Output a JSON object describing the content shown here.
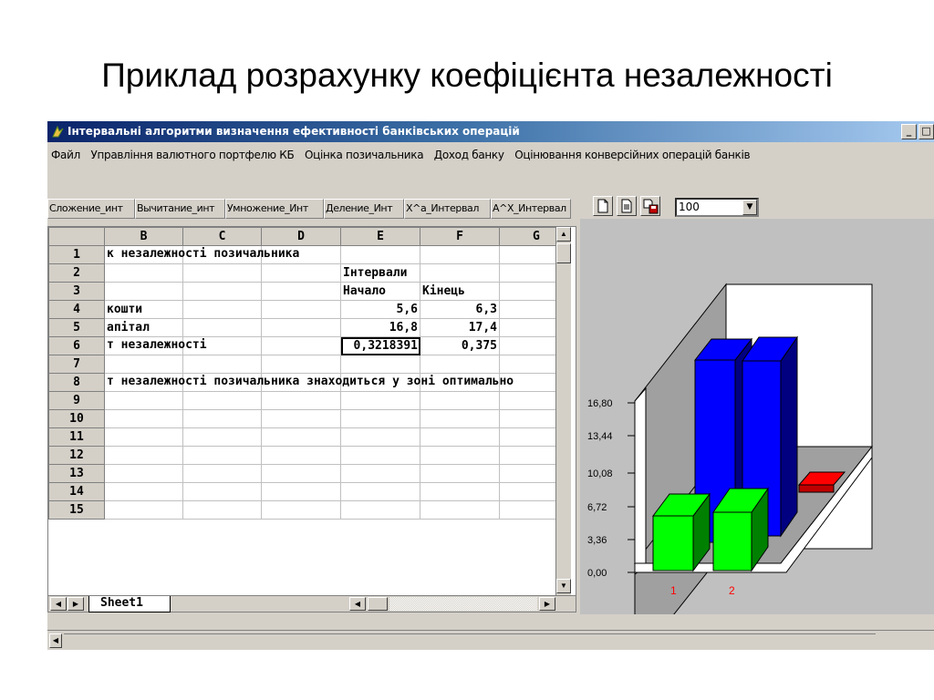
{
  "slide": {
    "title": "Приклад розрахунку коефіцієнта незалежності"
  },
  "window": {
    "title": "Інтервальні алгоритми визначення ефективності банківських операцій"
  },
  "menu": [
    "Файл",
    "Управління валютного портфелю КБ",
    "Оцінка позичальника",
    "Доход банку",
    "Оцінювання конверсійних операцій банків"
  ],
  "tabs": [
    "Сложение_инт",
    "Вычитание_инт",
    "Умножение_Инт",
    "Деление_Инт",
    "X^a_Интервал",
    "A^X_Интервал"
  ],
  "toolbar": {
    "zoom": "100"
  },
  "sheet": {
    "columns": [
      "B",
      "C",
      "D",
      "E",
      "F",
      "G"
    ],
    "rows": [
      {
        "n": "1",
        "text": "к незалежності позичальника",
        "e": "",
        "f": ""
      },
      {
        "n": "2",
        "text": "",
        "e": "Інтервали",
        "f": ""
      },
      {
        "n": "3",
        "text": "",
        "e": "Начало",
        "f": "Кінець"
      },
      {
        "n": "4",
        "text": "кошти",
        "e": "5,6",
        "f": "6,3"
      },
      {
        "n": "5",
        "text": "апітал",
        "e": "16,8",
        "f": "17,4"
      },
      {
        "n": "6",
        "text": "т незалежності",
        "e": "0,3218391",
        "f": "0,375"
      },
      {
        "n": "7",
        "text": "",
        "e": "",
        "f": ""
      },
      {
        "n": "8",
        "text": "т незалежності позичальника знаходиться у зоні оптимально",
        "e": "",
        "f": ""
      },
      {
        "n": "9",
        "text": "",
        "e": "",
        "f": ""
      },
      {
        "n": "10",
        "text": "",
        "e": "",
        "f": ""
      },
      {
        "n": "11",
        "text": "",
        "e": "",
        "f": ""
      },
      {
        "n": "12",
        "text": "",
        "e": "",
        "f": ""
      },
      {
        "n": "13",
        "text": "",
        "e": "",
        "f": ""
      },
      {
        "n": "14",
        "text": "",
        "e": "",
        "f": ""
      },
      {
        "n": "15",
        "text": "",
        "e": "",
        "f": ""
      }
    ],
    "sheet_tab": "Sheet1"
  },
  "chart": {
    "y_ticks": [
      "16,80",
      "13,44",
      "10,08",
      "6,72",
      "3,36",
      "0,00"
    ],
    "x_labels": [
      "1",
      "2"
    ],
    "colors": {
      "back": "#0000ff",
      "front": "#00ff00",
      "third": "#ff0000",
      "axis_label": "#ff0000"
    }
  }
}
